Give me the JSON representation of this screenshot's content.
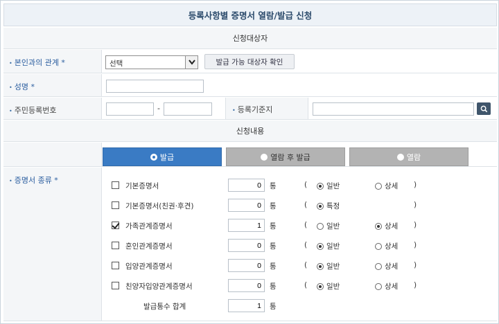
{
  "title": "등록사항별 증명서 열람/발급 신청",
  "section_target": "신청대상자",
  "section_content": "신청내용",
  "relation": {
    "label": "본인과의 관계 *",
    "select_value": "선택",
    "check_button": "발급 가능 대상자 확인"
  },
  "name": {
    "label": "성명 *",
    "value": ""
  },
  "rrn": {
    "label": "주민등록번호",
    "part1": "",
    "part2": "",
    "dash": "-"
  },
  "domicile": {
    "label": "등록기준지",
    "value": ""
  },
  "tabs": [
    {
      "label": "발급",
      "selected": true
    },
    {
      "label": "열람 후 발급",
      "selected": false
    },
    {
      "label": "열람",
      "selected": false
    }
  ],
  "cert_section_label": "증명서 종류 *",
  "unit": "통",
  "open_paren": "(",
  "close_paren": ")",
  "certificates": [
    {
      "name": "기본증명서",
      "checked": false,
      "qty": "0",
      "opt1": "일반",
      "opt1_on": true,
      "opt2": "상세",
      "opt2_on": false
    },
    {
      "name": "기본증명서(친권·후견)",
      "checked": false,
      "qty": "0",
      "opt1": "특정",
      "opt1_on": true,
      "opt2": "",
      "opt2_on": false
    },
    {
      "name": "가족관계증명서",
      "checked": true,
      "qty": "1",
      "opt1": "일반",
      "opt1_on": false,
      "opt2": "상세",
      "opt2_on": true
    },
    {
      "name": "혼인관계증명서",
      "checked": false,
      "qty": "0",
      "opt1": "일반",
      "opt1_on": true,
      "opt2": "상세",
      "opt2_on": false
    },
    {
      "name": "입양관계증명서",
      "checked": false,
      "qty": "0",
      "opt1": "일반",
      "opt1_on": true,
      "opt2": "상세",
      "opt2_on": false
    },
    {
      "name": "친양자입양관계증명서",
      "checked": false,
      "qty": "0",
      "opt1": "일반",
      "opt1_on": true,
      "opt2": "상세",
      "opt2_on": false
    }
  ],
  "total": {
    "label": "발급통수 합계",
    "value": "1"
  },
  "colors": {
    "accent": "#3a7bc4",
    "tab_inactive": "#b3b3b3",
    "label_blue": "#2a5d9f",
    "label_bg": "#f4f6f8"
  },
  "icons": {
    "search": "search-icon",
    "dropdown": "chevron-down-icon"
  }
}
